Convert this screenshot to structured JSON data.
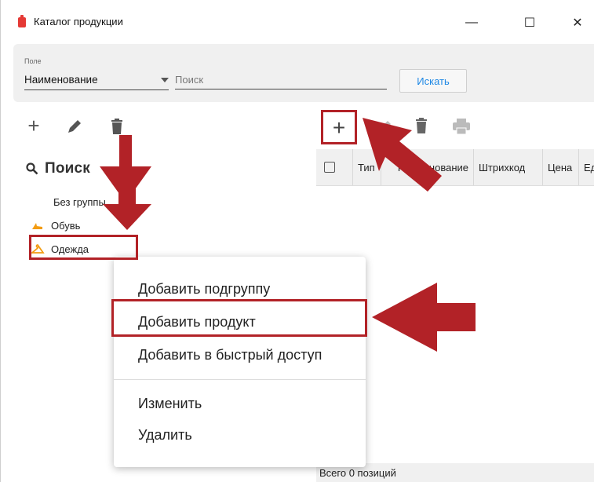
{
  "window": {
    "title": "Каталог продукции",
    "minimize": "—",
    "maximize": "☐",
    "close": "✕"
  },
  "search": {
    "field_caption": "Поле",
    "field_value": "Наименование",
    "placeholder": "Поиск",
    "button": "Искать"
  },
  "groups": {
    "search_label": "Поиск",
    "items": [
      {
        "label": "Без группы",
        "icon": "none"
      },
      {
        "label": "Обувь",
        "icon": "shoe-icon"
      },
      {
        "label": "Одежда",
        "icon": "hanger-icon"
      }
    ]
  },
  "table": {
    "columns": [
      "Тип",
      "Наименование",
      "Штрихкод",
      "Цена",
      "Ед"
    ],
    "total": "Всего 0 позиций"
  },
  "context_menu": {
    "items": [
      "Добавить подгруппу",
      "Добавить продукт",
      "Добавить в быстрый доступ",
      "Изменить",
      "Удалить"
    ]
  },
  "colors": {
    "accent": "#1e88e5",
    "highlight": "#b22227",
    "icon_orange": "#f39c12"
  }
}
